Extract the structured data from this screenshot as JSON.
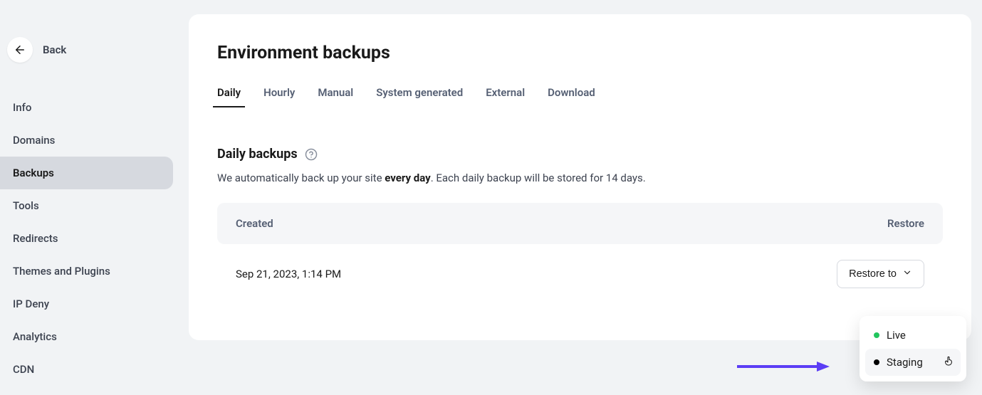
{
  "sidebar": {
    "back_label": "Back",
    "items": [
      {
        "label": "Info",
        "active": false
      },
      {
        "label": "Domains",
        "active": false
      },
      {
        "label": "Backups",
        "active": true
      },
      {
        "label": "Tools",
        "active": false
      },
      {
        "label": "Redirects",
        "active": false
      },
      {
        "label": "Themes and Plugins",
        "active": false
      },
      {
        "label": "IP Deny",
        "active": false
      },
      {
        "label": "Analytics",
        "active": false
      },
      {
        "label": "CDN",
        "active": false
      }
    ]
  },
  "page": {
    "title": "Environment backups"
  },
  "tabs": [
    {
      "label": "Daily",
      "active": true
    },
    {
      "label": "Hourly",
      "active": false
    },
    {
      "label": "Manual",
      "active": false
    },
    {
      "label": "System generated",
      "active": false
    },
    {
      "label": "External",
      "active": false
    },
    {
      "label": "Download",
      "active": false
    }
  ],
  "section": {
    "title": "Daily backups",
    "desc_prefix": "We automatically back up your site ",
    "desc_strong": "every day",
    "desc_suffix": ". Each daily backup will be stored for 14 days."
  },
  "table": {
    "col_created": "Created",
    "col_restore": "Restore",
    "rows": [
      {
        "created": "Sep 21, 2023, 1:14 PM",
        "restore_label": "Restore to"
      }
    ]
  },
  "dropdown": {
    "items": [
      {
        "label": "Live",
        "dot": "green",
        "hover": false
      },
      {
        "label": "Staging",
        "dot": "black",
        "hover": true
      }
    ]
  },
  "colors": {
    "accent_arrow": "#5b3df5",
    "dot_live": "#22c55e"
  }
}
